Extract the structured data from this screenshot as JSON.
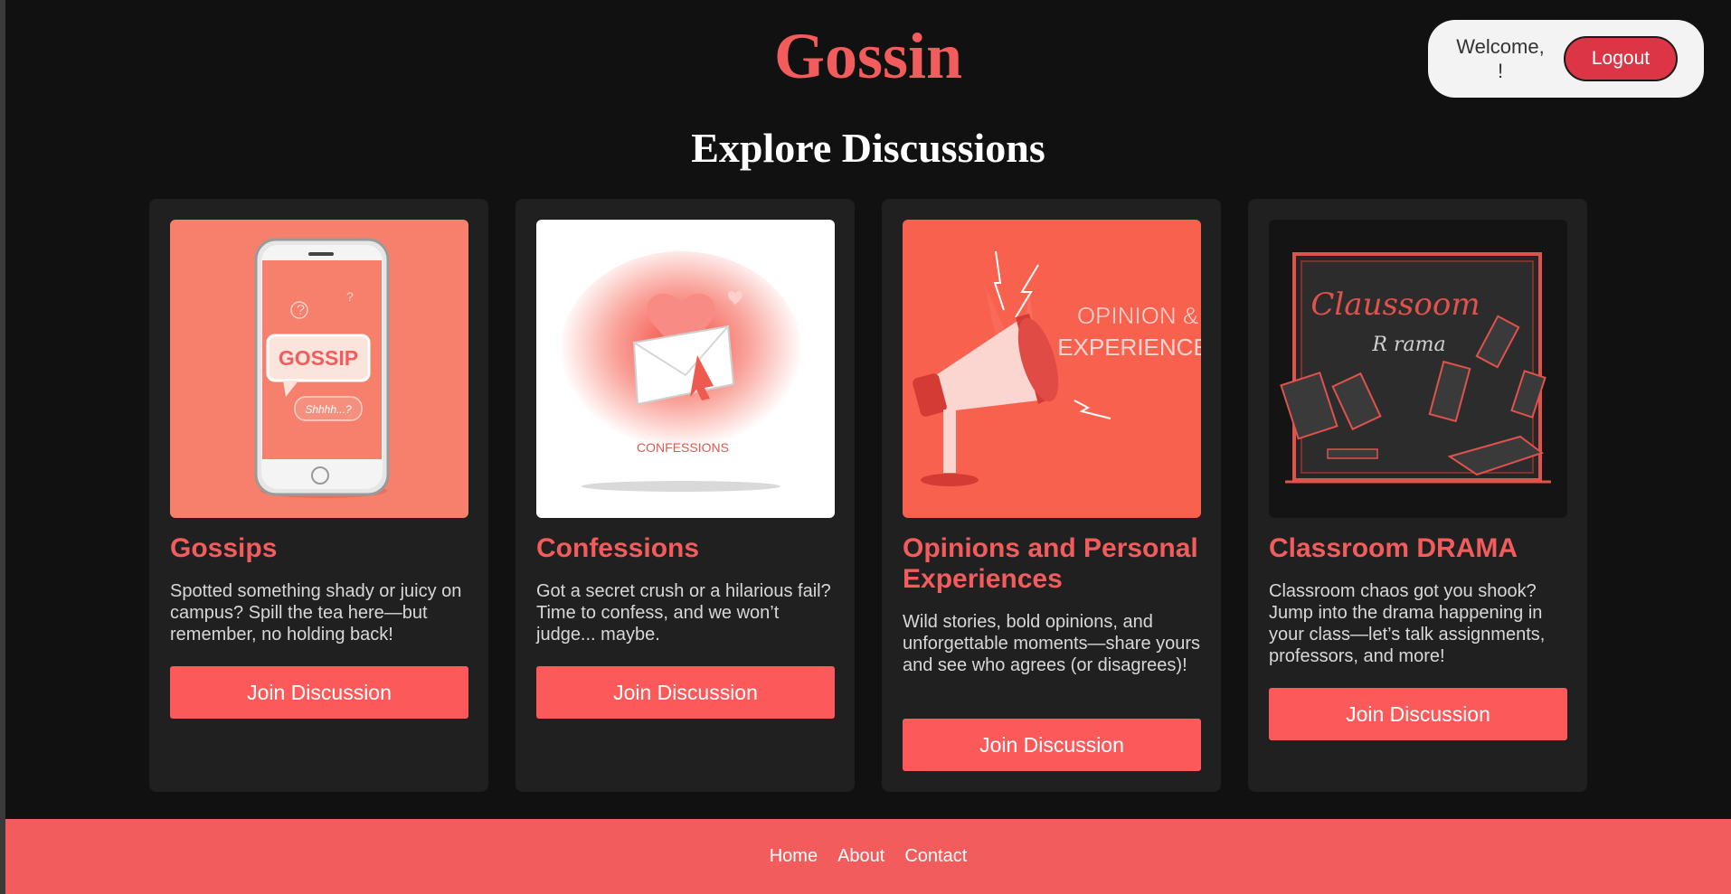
{
  "header": {
    "brand": "Gossin",
    "welcome": "Welcome,",
    "welcome_suffix": "!",
    "logout_label": "Logout"
  },
  "page": {
    "heading": "Explore Discussions"
  },
  "cards": [
    {
      "title": "Gossips",
      "description": "Spotted something shady or juicy on campus? Spill the tea here—but remember, no holding back!",
      "button": "Join Discussion",
      "image_text": "GOSSIP",
      "image_subtext": "Shhhh...?"
    },
    {
      "title": "Confessions",
      "description": "Got a secret crush or a hilarious fail? Time to confess, and we won’t judge... maybe.",
      "button": "Join Discussion",
      "image_text": "CONFESSIONS"
    },
    {
      "title": "Opinions and Personal Experiences",
      "description": "Wild stories, bold opinions, and unforgettable moments—share yours and see who agrees (or disagrees)!",
      "button": "Join Discussion",
      "image_text": "OPINION &",
      "image_text2": "EXPERIENCE"
    },
    {
      "title": "Classroom DRAMA",
      "description": "Classroom chaos got you shook? Jump into the drama happening in your class—let’s talk assignments, professors, and more!",
      "button": "Join Discussion",
      "image_text": "Claussoom",
      "image_text2": "R rama"
    }
  ],
  "footer": {
    "links": [
      "Home",
      "About",
      "Contact"
    ]
  },
  "colors": {
    "accent": "#f25c5c",
    "button": "#fc5a5a",
    "logout": "#dc3545",
    "background": "#111111",
    "card": "#202020"
  }
}
